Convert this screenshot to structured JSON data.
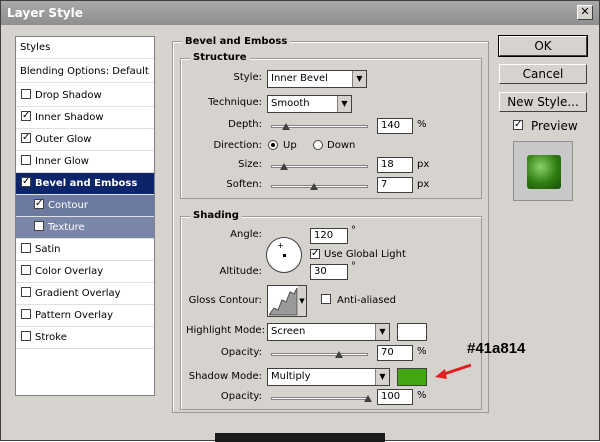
{
  "window": {
    "title": "Layer Style"
  },
  "left_panel": {
    "styles_label": "Styles",
    "blending_label": "Blending Options: Default",
    "items": [
      {
        "label": "Drop Shadow",
        "checked": false
      },
      {
        "label": "Inner Shadow",
        "checked": true
      },
      {
        "label": "Outer Glow",
        "checked": true
      },
      {
        "label": "Inner Glow",
        "checked": false
      },
      {
        "label": "Bevel and Emboss",
        "checked": true
      },
      {
        "label": "Contour",
        "checked": true
      },
      {
        "label": "Texture",
        "checked": false
      },
      {
        "label": "Satin",
        "checked": false
      },
      {
        "label": "Color Overlay",
        "checked": false
      },
      {
        "label": "Gradient Overlay",
        "checked": false
      },
      {
        "label": "Pattern Overlay",
        "checked": false
      },
      {
        "label": "Stroke",
        "checked": false
      }
    ]
  },
  "bevel": {
    "section_title": "Bevel and Emboss",
    "structure": {
      "title": "Structure",
      "style_label": "Style:",
      "style_value": "Inner Bevel",
      "technique_label": "Technique:",
      "technique_value": "Smooth",
      "depth_label": "Depth:",
      "depth_value": "140",
      "depth_unit": "%",
      "direction_label": "Direction:",
      "direction_up": "Up",
      "direction_down": "Down",
      "size_label": "Size:",
      "size_value": "18",
      "size_unit": "px",
      "soften_label": "Soften:",
      "soften_value": "7",
      "soften_unit": "px"
    },
    "shading": {
      "title": "Shading",
      "angle_label": "Angle:",
      "angle_value": "120",
      "degree": "°",
      "global_light_label": "Use Global Light",
      "altitude_label": "Altitude:",
      "altitude_value": "30",
      "gloss_label": "Gloss Contour:",
      "antialiased_label": "Anti-aliased",
      "highlight_mode_label": "Highlight Mode:",
      "highlight_mode_value": "Screen",
      "highlight_color": "#ffffff",
      "highlight_opacity_label": "Opacity:",
      "highlight_opacity_value": "70",
      "shadow_mode_label": "Shadow Mode:",
      "shadow_mode_value": "Multiply",
      "shadow_color": "#41a814",
      "shadow_opacity_label": "Opacity:",
      "shadow_opacity_value": "100",
      "pct": "%"
    }
  },
  "buttons": {
    "ok": "OK",
    "cancel": "Cancel",
    "new_style": "New Style...",
    "preview": "Preview"
  },
  "annotation": {
    "text": "#41a814",
    "color": "#e02020"
  }
}
